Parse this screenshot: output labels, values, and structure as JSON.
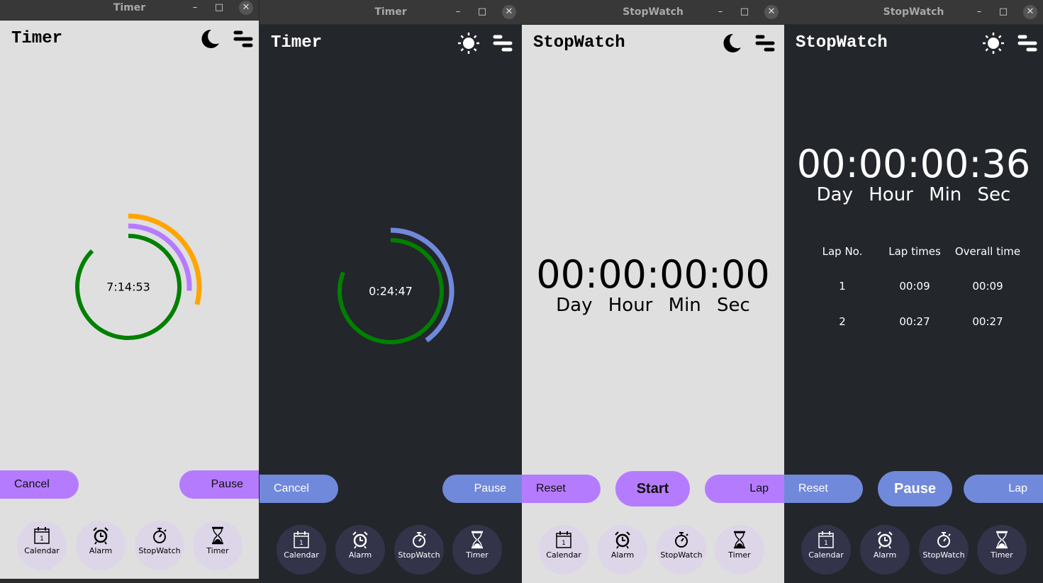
{
  "colors": {
    "light_bg": "#dfdfdf",
    "dark_bg": "#23262b",
    "purple": "#b57bff",
    "blue": "#7189da",
    "green": "#008000",
    "orange": "#ffa500"
  },
  "nav": [
    {
      "label": "Calendar",
      "icon": "calendar-icon",
      "day": "1"
    },
    {
      "label": "Alarm",
      "icon": "alarm-icon"
    },
    {
      "label": "StopWatch",
      "icon": "stopwatch-icon"
    },
    {
      "label": "Timer",
      "icon": "hourglass-icon"
    }
  ],
  "windows": [
    {
      "title": "Timer",
      "header": "Timer",
      "theme": "light",
      "theme_icon": "moon-icon",
      "time": "7:14:53",
      "rings": [
        {
          "color": "#008000",
          "progress": 0.875
        },
        {
          "color": "#b57bff",
          "progress": 0.26
        },
        {
          "color": "#ffa500",
          "progress": 0.29
        }
      ],
      "buttons": {
        "left": "Cancel",
        "right": "Pause"
      }
    },
    {
      "title": "Timer",
      "header": "Timer",
      "theme": "dark",
      "theme_icon": "sun-icon",
      "time": "0:24:47",
      "rings": [
        {
          "color": "#008000",
          "progress": 0.81
        },
        {
          "color": "#7189da",
          "progress": 0.4
        }
      ],
      "buttons": {
        "left": "Cancel",
        "right": "Pause"
      }
    },
    {
      "title": "StopWatch",
      "header": "StopWatch",
      "theme": "light",
      "theme_icon": "moon-icon",
      "time": "00:00:00:00",
      "units": "Day Hour Min Sec",
      "buttons": {
        "left": "Reset",
        "middle": "Start",
        "right": "Lap"
      }
    },
    {
      "title": "StopWatch",
      "header": "StopWatch",
      "theme": "dark",
      "theme_icon": "sun-icon",
      "time": "00:00:00:36",
      "units": "Day Hour Min Sec",
      "buttons": {
        "left": "Reset",
        "middle": "Pause",
        "right": "Lap"
      },
      "laps": {
        "headers": [
          "Lap No.",
          "Lap times",
          "Overall time"
        ],
        "rows": [
          [
            "1",
            "00:09",
            "00:09"
          ],
          [
            "2",
            "00:27",
            "00:27"
          ]
        ]
      }
    }
  ]
}
